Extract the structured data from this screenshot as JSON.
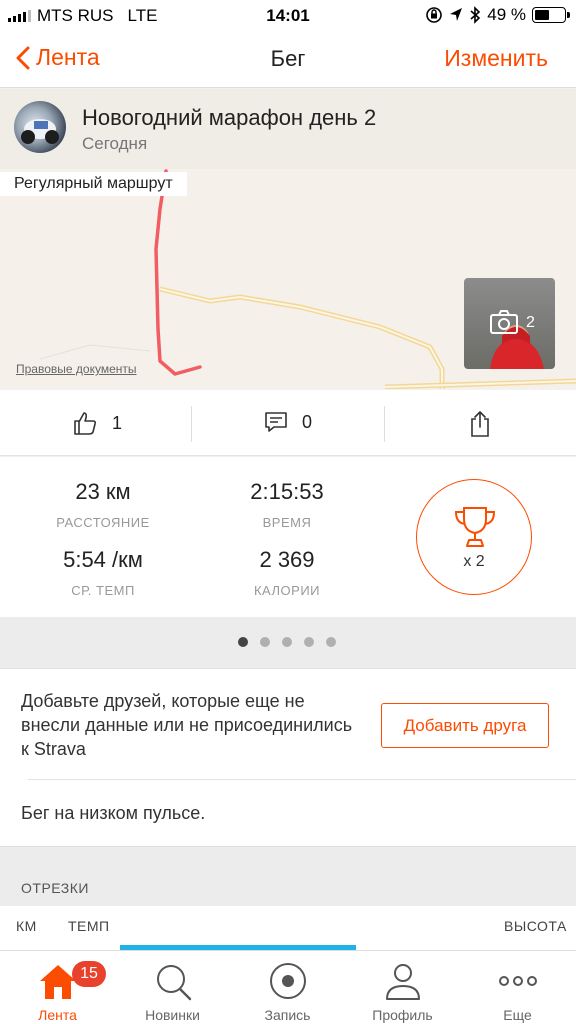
{
  "status_bar": {
    "carrier": "MTS RUS",
    "network": "LTE",
    "time": "14:01",
    "battery": "49 %",
    "battery_level": 0.49
  },
  "nav": {
    "back_label": "Лента",
    "title": "Бег",
    "edit_label": "Изменить"
  },
  "activity": {
    "title": "Новогодний марафон день 2",
    "date": "Сегодня",
    "route_label": "Регулярный маршрут",
    "legal_link": "Правовые документы",
    "photo_count": "2"
  },
  "social": {
    "kudos_count": "1",
    "comments_count": "0"
  },
  "stats": {
    "distance_value": "23 км",
    "distance_label": "РАССТОЯНИЕ",
    "time_value": "2:15:53",
    "time_label": "ВРЕМЯ",
    "pace_value": "5:54 /км",
    "pace_label": "СР. ТЕМП",
    "calories_value": "2 369",
    "calories_label": "КАЛОРИИ",
    "achievements_count": "x 2"
  },
  "pager": {
    "total": 5,
    "active_index": 0
  },
  "friends": {
    "prompt": "Добавьте друзей, которые еще не внесли данные или не присоединились к Strava",
    "add_button": "Добавить друга"
  },
  "description": "Бег на низком пульсе.",
  "segments": {
    "header": "ОТРЕЗКИ",
    "columns": {
      "km": "КМ",
      "pace": "ТЕМП",
      "elevation": "ВЫСОТА"
    }
  },
  "tabs": [
    {
      "label": "Лента",
      "icon": "home-icon",
      "badge": "15",
      "active": true
    },
    {
      "label": "Новинки",
      "icon": "search-icon",
      "active": false
    },
    {
      "label": "Запись",
      "icon": "record-icon",
      "active": false
    },
    {
      "label": "Профиль",
      "icon": "profile-icon",
      "active": false
    },
    {
      "label": "Еще",
      "icon": "more-icon",
      "active": false
    }
  ],
  "colors": {
    "accent": "#fc4c02",
    "route": "#f25c63",
    "badge": "#e8412c",
    "pace_bar": "#20b2e6"
  }
}
